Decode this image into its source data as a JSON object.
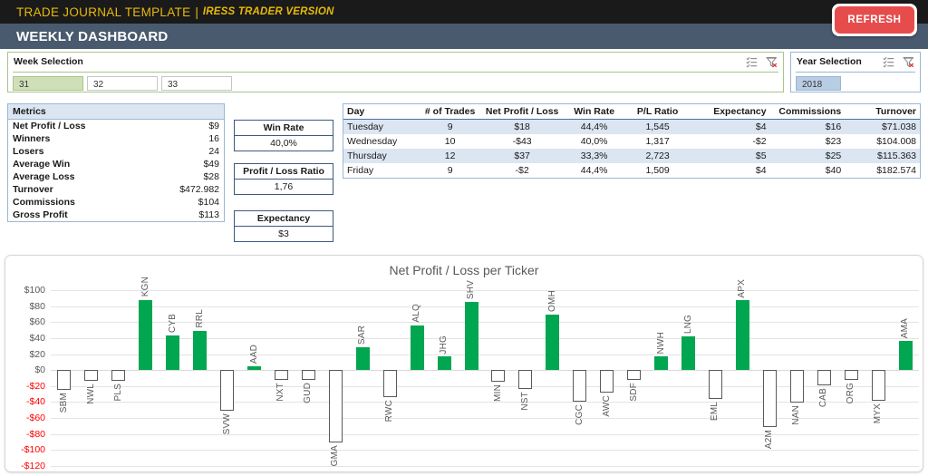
{
  "titlebar": {
    "main": "TRADE JOURNAL TEMPLATE",
    "separator": "|",
    "sub": "IRESS TRADER VERSION"
  },
  "subheader": {
    "title": "WEEKLY DASHBOARD"
  },
  "refresh": {
    "label": "REFRESH",
    "color": "#e74c4c"
  },
  "week_slicer": {
    "title": "Week Selection",
    "multiselect_icon": "multi-select-icon",
    "clear_icon": "clear-filter-icon",
    "items": [
      {
        "label": "31",
        "selected": true
      },
      {
        "label": "32",
        "selected": false
      },
      {
        "label": "33",
        "selected": false
      }
    ]
  },
  "year_slicer": {
    "title": "Year Selection",
    "multiselect_icon": "multi-select-icon",
    "clear_icon": "clear-filter-icon",
    "items": [
      {
        "label": "2018",
        "selected": true
      }
    ]
  },
  "metrics": {
    "header": "Metrics",
    "rows": [
      {
        "label": "Net Profit / Loss",
        "value": "$9"
      },
      {
        "label": "Winners",
        "value": "16"
      },
      {
        "label": "Losers",
        "value": "24"
      },
      {
        "label": "Average Win",
        "value": "$49"
      },
      {
        "label": "Average Loss",
        "value": "$28"
      },
      {
        "label": "Turnover",
        "value": "$472.982"
      },
      {
        "label": "Commissions",
        "value": "$104"
      },
      {
        "label": "Gross Profit",
        "value": "$113"
      }
    ]
  },
  "kpis": [
    {
      "title": "Win Rate",
      "value": "40,0%"
    },
    {
      "title": "Profit / Loss Ratio",
      "value": "1,76"
    },
    {
      "title": "Expectancy",
      "value": "$3"
    }
  ],
  "day_table": {
    "columns": [
      "Day",
      "# of Trades",
      "Net Profit / Loss",
      "Win Rate",
      "P/L Ratio",
      "Expectancy",
      "Commissions",
      "Turnover"
    ],
    "rows": [
      {
        "day": "Tuesday",
        "trades": "9",
        "npl": "$18",
        "npl_neg": false,
        "win_rate": "44,4%",
        "pl_ratio": "1,545",
        "expectancy": "$4",
        "exp_neg": false,
        "commissions": "$16",
        "turnover": "$71.038"
      },
      {
        "day": "Wednesday",
        "trades": "10",
        "npl": "-$43",
        "npl_neg": true,
        "win_rate": "40,0%",
        "pl_ratio": "1,317",
        "expectancy": "-$2",
        "exp_neg": false,
        "commissions": "$23",
        "turnover": "$104.008"
      },
      {
        "day": "Thursday",
        "trades": "12",
        "npl": "$37",
        "npl_neg": false,
        "win_rate": "33,3%",
        "pl_ratio": "2,723",
        "expectancy": "$5",
        "exp_neg": false,
        "commissions": "$25",
        "turnover": "$115.363"
      },
      {
        "day": "Friday",
        "trades": "9",
        "npl": "-$2",
        "npl_neg": true,
        "win_rate": "44,4%",
        "pl_ratio": "1,509",
        "expectancy": "$4",
        "exp_neg": false,
        "commissions": "$40",
        "turnover": "$182.574"
      }
    ]
  },
  "chart_data": {
    "type": "bar",
    "title": "Net Profit / Loss per Ticker",
    "xlabel": "",
    "ylabel": "",
    "ylim": [
      -120,
      100
    ],
    "ytick_step": 20,
    "ytick_labels": [
      "$100",
      "$80",
      "$60",
      "$40",
      "$20",
      "$0",
      "-$20",
      "-$40",
      "-$60",
      "-$80",
      "-$100",
      "-$120"
    ],
    "grid": true,
    "legend": "none",
    "positive_color": "#00a650",
    "negative_color": "#ffffff",
    "negative_border": "#595959",
    "categories": [
      "SBM",
      "NWL",
      "PLS",
      "KGN",
      "CYB",
      "RRL",
      "SVW",
      "AAD",
      "NXT",
      "GUD",
      "GMA",
      "SAR",
      "RWC",
      "ALQ",
      "JHG",
      "SHV",
      "MIN",
      "NST",
      "OMH",
      "CGC",
      "AWC",
      "SDF",
      "NWH",
      "LNG",
      "EML",
      "APX",
      "A2M",
      "NAN",
      "CAB",
      "ORG",
      "MYX",
      "AMA"
    ],
    "values": [
      -25,
      -13,
      -13,
      88,
      43,
      49,
      -51,
      5,
      -12,
      -12,
      -91,
      28,
      -34,
      56,
      17,
      85,
      -14,
      -24,
      69,
      -39,
      -28,
      -12,
      17,
      42,
      -36,
      87,
      -71,
      -41,
      -19,
      -12,
      -38,
      36
    ]
  }
}
